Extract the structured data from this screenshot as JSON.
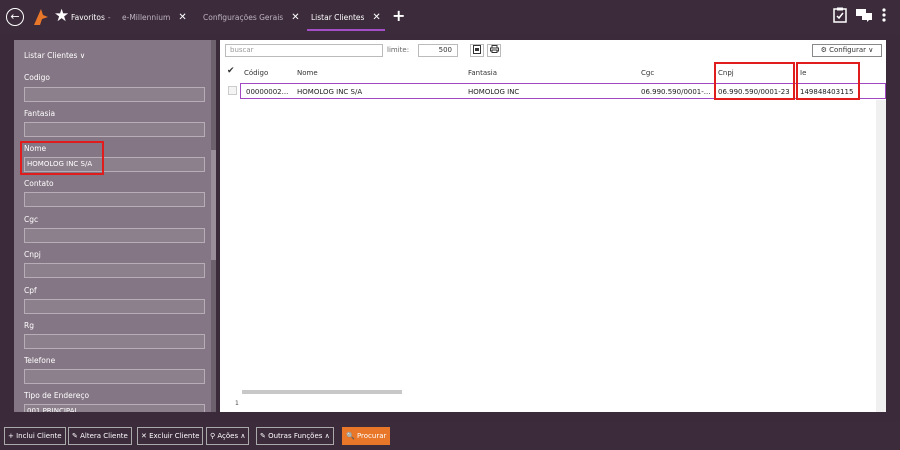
{
  "topbar": {
    "back_icon": "←",
    "favorites_label": "Favoritos",
    "favorites_dash": "-",
    "tabs": [
      {
        "label": "e-Millennium"
      },
      {
        "label": "Configurações Gerais"
      },
      {
        "label": "Listar Clientes"
      }
    ],
    "add_tab_icon": "+"
  },
  "left_panel": {
    "title": "Listar Clientes ∨",
    "fields": [
      {
        "label": "Codigo",
        "value": ""
      },
      {
        "label": "Fantasia",
        "value": ""
      },
      {
        "label": "Nome",
        "value": "HOMOLOG INC S/A"
      },
      {
        "label": "Contato",
        "value": ""
      },
      {
        "label": "Cgc",
        "value": ""
      },
      {
        "label": "Cnpj",
        "value": ""
      },
      {
        "label": "Cpf",
        "value": ""
      },
      {
        "label": "Rg",
        "value": ""
      },
      {
        "label": "Telefone",
        "value": ""
      },
      {
        "label": "Tipo de Endereço",
        "value": "001 PRINCIPAL"
      }
    ]
  },
  "grid": {
    "search_placeholder": "buscar",
    "limite_label": "limite:",
    "limite_value": "500",
    "config_label": "⚙ Configurar ∨",
    "columns": [
      "Código",
      "Nome",
      "Fantasia",
      "Cgc",
      "Cnpj",
      "Ie"
    ],
    "rows": [
      {
        "codigo": "00000002...",
        "nome": "HOMOLOG INC S/A",
        "fantasia": "HOMOLOG INC",
        "cgc": "06.990.590/0001-...",
        "cnpj": "06.990.590/0001-23",
        "ie": "149848403115"
      }
    ],
    "page": "1"
  },
  "bottombar": {
    "buttons": [
      {
        "label": "+ Inclui Cliente"
      },
      {
        "label": "✎ Altera Cliente"
      },
      {
        "label": "✕ Excluir Cliente"
      },
      {
        "label": "⚲ Ações ∧"
      },
      {
        "label": "✎ Outras Funções ∧"
      },
      {
        "label": "🔍 Procurar"
      }
    ]
  },
  "colors": {
    "topbar": "#3b2b3b",
    "panel": "#847684",
    "accent": "#a34ec7",
    "highlight": "#e01c1c",
    "search_button": "#e8772a"
  }
}
